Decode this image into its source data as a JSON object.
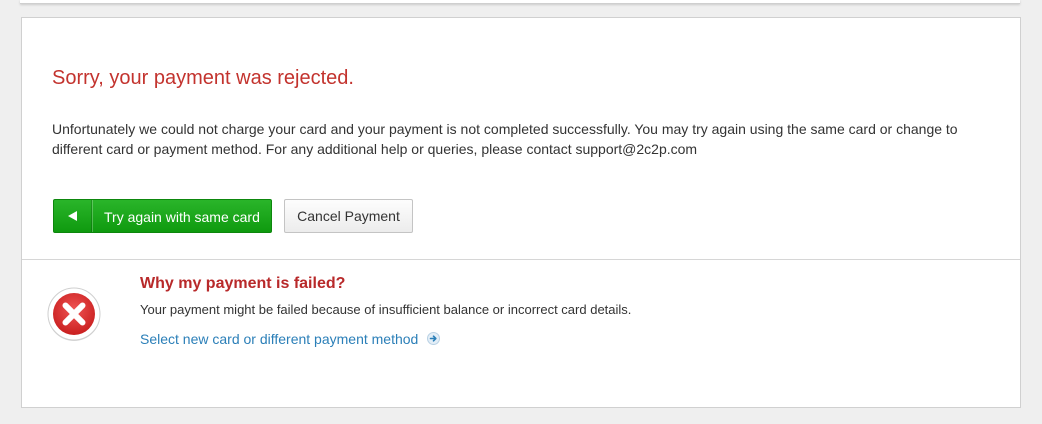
{
  "result": {
    "title": "Sorry, your payment was rejected.",
    "message": "Unfortunately we could not charge your card and your payment is not completed successfully. You may try again using the same card or change to different card or payment method. For any additional help or queries, please contact support@2c2p.com"
  },
  "actions": {
    "retry_label": "Try again with same card",
    "cancel_label": "Cancel Payment"
  },
  "failure_info": {
    "icon": "error-x-icon",
    "title": "Why my payment is failed?",
    "description": "Your payment might be failed because of insufficient balance or incorrect card details.",
    "link_label": "Select new card or different payment method",
    "link_icon": "arrow-right-circle-icon"
  },
  "colors": {
    "error_title": "#c3332e",
    "retry_button": "#1aa51a",
    "link": "#2b7fb8",
    "error_icon": "#d93535"
  }
}
